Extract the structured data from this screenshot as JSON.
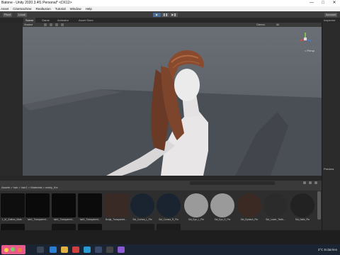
{
  "window": {
    "title": "Batone - Unity 2020.3.4f1 Personal* <DX12>",
    "controls": [
      "—",
      "□",
      "✕"
    ]
  },
  "menu": [
    "Asset",
    "Cinemachine",
    "Realtusion",
    "Tutorial",
    "Window",
    "Help"
  ],
  "toolbar": {
    "left_buttons": [
      "Pivot",
      "Local"
    ],
    "play_buttons": [
      "▶",
      "❚❚",
      "▶❚"
    ],
    "right_label": "Account"
  },
  "tabs": {
    "main": [
      "Scene",
      "Game",
      "Animator",
      "Asset Store"
    ],
    "right": "Inspector"
  },
  "scene_toolbar": {
    "shading": "Shaded",
    "gizmos": "Gizmos",
    "search": "All"
  },
  "viewport": {
    "perspective_label": "< Persp",
    "gizmo_axes": [
      "x",
      "y",
      "z"
    ]
  },
  "right_panel": {
    "inspector": "Inspector",
    "preview": "Preview"
  },
  "bottom": {
    "path": "Assets > hair > hair1 > Materials > winky_fbx",
    "assets": [
      {
        "name": "1_M_Clothes_Mate...",
        "color": "#0e0e0e"
      },
      {
        "name": "hair1_Transparent...",
        "color": "#0a0a0a"
      },
      {
        "name": "hair1_Transparent...",
        "color": "#090909"
      },
      {
        "name": "hair1_Transparent...",
        "color": "#0b0b0b"
      },
      {
        "name": "Bodja_Transparent...",
        "color": "#3a2a26"
      },
      {
        "name": "Std_Cornea_L_Pbr",
        "color": "#1a2430"
      },
      {
        "name": "Std_Cornea_R_Pbr",
        "color": "#1a2430"
      },
      {
        "name": "Std_Eye_L_Pbr",
        "color": "#9a9a9a"
      },
      {
        "name": "Std_Eye_R_Pbr",
        "color": "#9a9a9a"
      },
      {
        "name": "Std_Eyelash_Pbr",
        "color": "#3b2a24"
      },
      {
        "name": "Std_Lower_Teeth...",
        "color": "#2b2b2b"
      },
      {
        "name": "Std_Nails_Pbr",
        "color": "#222222"
      }
    ]
  },
  "taskbar": {
    "weather": "3°C  Eclairées",
    "icons": [
      {
        "name": "browser-icon",
        "color": "#2d7dd2"
      },
      {
        "name": "folder-icon",
        "color": "#e0b040"
      },
      {
        "name": "mail-icon",
        "color": "#d04040"
      },
      {
        "name": "edge-icon",
        "color": "#2a9ad0"
      },
      {
        "name": "steam-icon",
        "color": "#3a4a6a"
      },
      {
        "name": "chrome-icon",
        "color": "#d8d8d8"
      },
      {
        "name": "unity-icon",
        "color": "#444444"
      },
      {
        "name": "vs-icon",
        "color": "#8a5ad0"
      }
    ]
  }
}
